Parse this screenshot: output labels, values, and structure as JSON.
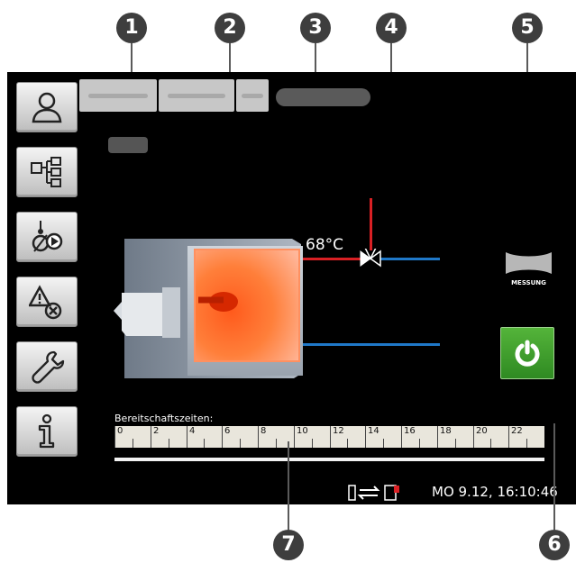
{
  "callouts": [
    "1",
    "2",
    "3",
    "4",
    "5",
    "6",
    "7"
  ],
  "boiler": {
    "flow_temp": "68°C"
  },
  "measure_button": {
    "label": "MESSUNG"
  },
  "standby": {
    "label": "Bereitschaftszeiten:",
    "ticks": [
      "0",
      "2",
      "4",
      "6",
      "8",
      "10",
      "12",
      "14",
      "16",
      "18",
      "20",
      "22"
    ]
  },
  "status_bar": {
    "datetime": "MO  9.12, 16:10:46"
  },
  "sidebar": {
    "icons": [
      "user-icon",
      "system-overview-icon",
      "function-test-icon",
      "fault-reset-icon",
      "wrench-icon",
      "info-icon"
    ]
  },
  "colors": {
    "flow": "#d92024",
    "return": "#1f78c8",
    "power_button": "#3e9e2a"
  }
}
